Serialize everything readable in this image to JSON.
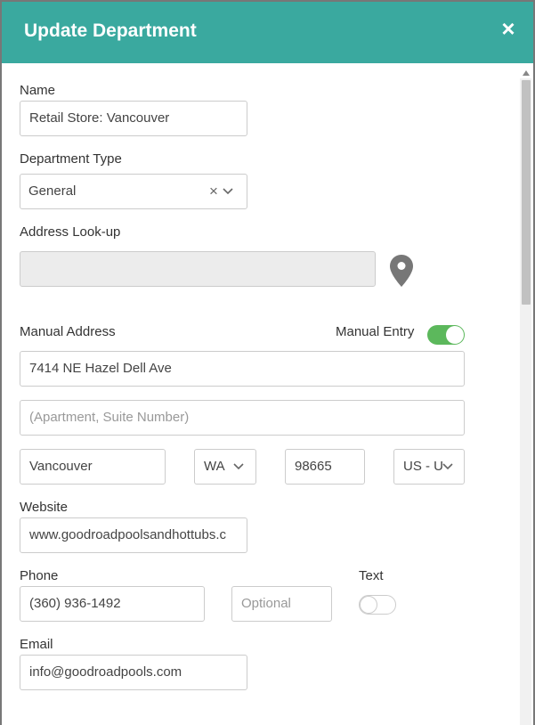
{
  "modal": {
    "title": "Update Department",
    "close_symbol": "×"
  },
  "form": {
    "name": {
      "label": "Name",
      "value": "Retail Store: Vancouver"
    },
    "department_type": {
      "label": "Department Type",
      "value": "General",
      "clear_symbol": "×"
    },
    "address_lookup": {
      "label": "Address Look-up",
      "value": "",
      "icon": "map-pin-icon"
    },
    "manual_address": {
      "label": "Manual Address",
      "manual_entry_label": "Manual Entry",
      "manual_entry_on": true,
      "street": "7414 NE Hazel Dell Ave",
      "street2_placeholder": "(Apartment, Suite Number)",
      "city": "Vancouver",
      "state": "WA",
      "zip": "98665",
      "country": "US - U"
    },
    "website": {
      "label": "Website",
      "value": "www.goodroadpoolsandhottubs.c"
    },
    "phone": {
      "label": "Phone",
      "value": "(360) 936-1492",
      "ext_placeholder": "Optional"
    },
    "text": {
      "label": "Text",
      "on": false
    },
    "email": {
      "label": "Email",
      "value": "info@goodroadpools.com"
    }
  },
  "colors": {
    "header": "#3aa99f",
    "toggle_on": "#5cb85c",
    "toggle_off": "#ffffff"
  }
}
